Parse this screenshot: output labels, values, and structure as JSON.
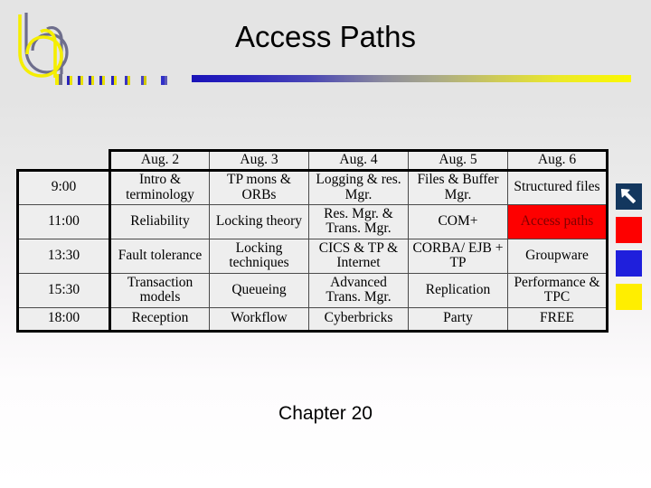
{
  "slide": {
    "title": "Access Paths",
    "footer": "Chapter 20"
  },
  "logo": {
    "name": "bn-logo",
    "colors": {
      "yellow": "#f5ee00",
      "gray_purple": "#6e6e8c"
    }
  },
  "title_rule": {
    "gradient_from": "#1a13b8",
    "gradient_to": "#fbf800"
  },
  "schedule": {
    "corner_label": "",
    "columns": [
      "Aug. 2",
      "Aug. 3",
      "Aug. 4",
      "Aug. 5",
      "Aug. 6"
    ],
    "rows": [
      {
        "time": "9:00",
        "cells": [
          {
            "text": "Intro & terminology",
            "highlight": false
          },
          {
            "text": "TP mons & ORBs",
            "highlight": false
          },
          {
            "text": "Logging & res. Mgr.",
            "highlight": false
          },
          {
            "text": "Files & Buffer Mgr.",
            "highlight": false
          },
          {
            "text": "Structured files",
            "highlight": false
          }
        ]
      },
      {
        "time": "11:00",
        "cells": [
          {
            "text": "Reliability",
            "highlight": false
          },
          {
            "text": "Locking theory",
            "highlight": false
          },
          {
            "text": "Res. Mgr. & Trans. Mgr.",
            "highlight": false
          },
          {
            "text": "COM+",
            "highlight": false
          },
          {
            "text": "Access paths",
            "highlight": true
          }
        ]
      },
      {
        "time": "13:30",
        "cells": [
          {
            "text": "Fault tolerance",
            "highlight": false
          },
          {
            "text": "Locking techniques",
            "highlight": false
          },
          {
            "text": "CICS & TP & Internet",
            "highlight": false
          },
          {
            "text": "CORBA/ EJB + TP",
            "highlight": false
          },
          {
            "text": "Groupware",
            "highlight": false
          }
        ]
      },
      {
        "time": "15:30",
        "cells": [
          {
            "text": "Transaction models",
            "highlight": false
          },
          {
            "text": "Queueing",
            "highlight": false
          },
          {
            "text": "Advanced Trans. Mgr.",
            "highlight": false
          },
          {
            "text": "Replication",
            "highlight": false
          },
          {
            "text": "Performance & TPC",
            "highlight": false
          }
        ]
      },
      {
        "time": "18:00",
        "cells": [
          {
            "text": "Reception",
            "highlight": false
          },
          {
            "text": "Workflow",
            "highlight": false
          },
          {
            "text": "Cyberbricks",
            "highlight": false
          },
          {
            "text": "Party",
            "highlight": false
          },
          {
            "text": "FREE",
            "highlight": false
          }
        ]
      }
    ],
    "highlight_color": "#fe0000",
    "highlight_text_color": "#7e0000"
  },
  "swatches": [
    {
      "name": "pointer-swatch",
      "color": "#13375e",
      "icon": "arrow-up-left-icon"
    },
    {
      "name": "red-swatch",
      "color": "#fe0000",
      "icon": ""
    },
    {
      "name": "blue-swatch",
      "color": "#1f1fdc",
      "icon": ""
    },
    {
      "name": "yellow-swatch",
      "color": "#ffee00",
      "icon": ""
    }
  ]
}
